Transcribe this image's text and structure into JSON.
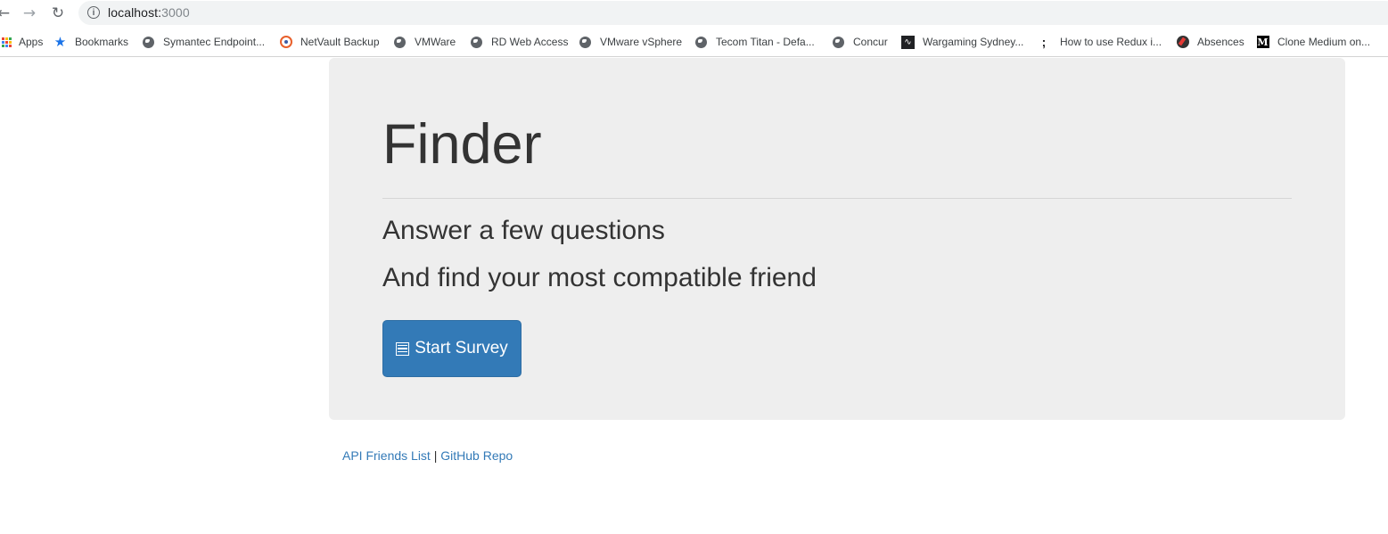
{
  "browser": {
    "url_host": "localhost:",
    "url_port": "3000",
    "bookmarks": [
      {
        "label": "Apps",
        "icon": "apps-grid-icon"
      },
      {
        "label": "Bookmarks",
        "icon": "star-icon"
      },
      {
        "label": "Symantec Endpoint...",
        "icon": "globe-icon"
      },
      {
        "label": "NetVault Backup",
        "icon": "netvault-icon"
      },
      {
        "label": "VMWare",
        "icon": "globe-icon"
      },
      {
        "label": "RD Web Access",
        "icon": "globe-icon"
      },
      {
        "label": "VMware vSphere",
        "icon": "globe-icon"
      },
      {
        "label": "Tecom Titan - Defa...",
        "icon": "globe-icon"
      },
      {
        "label": "Concur",
        "icon": "globe-icon"
      },
      {
        "label": "Wargaming Sydney...",
        "icon": "pulse-icon"
      },
      {
        "label": "How to use Redux i...",
        "icon": "dots-icon"
      },
      {
        "label": "Absences",
        "icon": "absences-icon"
      },
      {
        "label": "Clone Medium on...",
        "icon": "medium-icon"
      }
    ]
  },
  "jumbotron": {
    "title": "Finder",
    "subtitle_1": "Answer a few questions",
    "subtitle_2": "And find your most compatible friend",
    "button_label": "Start Survey"
  },
  "footer": {
    "link_api": "API Friends List",
    "separator": "|",
    "link_github": "GitHub Repo"
  },
  "colors": {
    "primary": "#337ab7",
    "jumbotron_bg": "#eeeeee",
    "text": "#333333"
  }
}
